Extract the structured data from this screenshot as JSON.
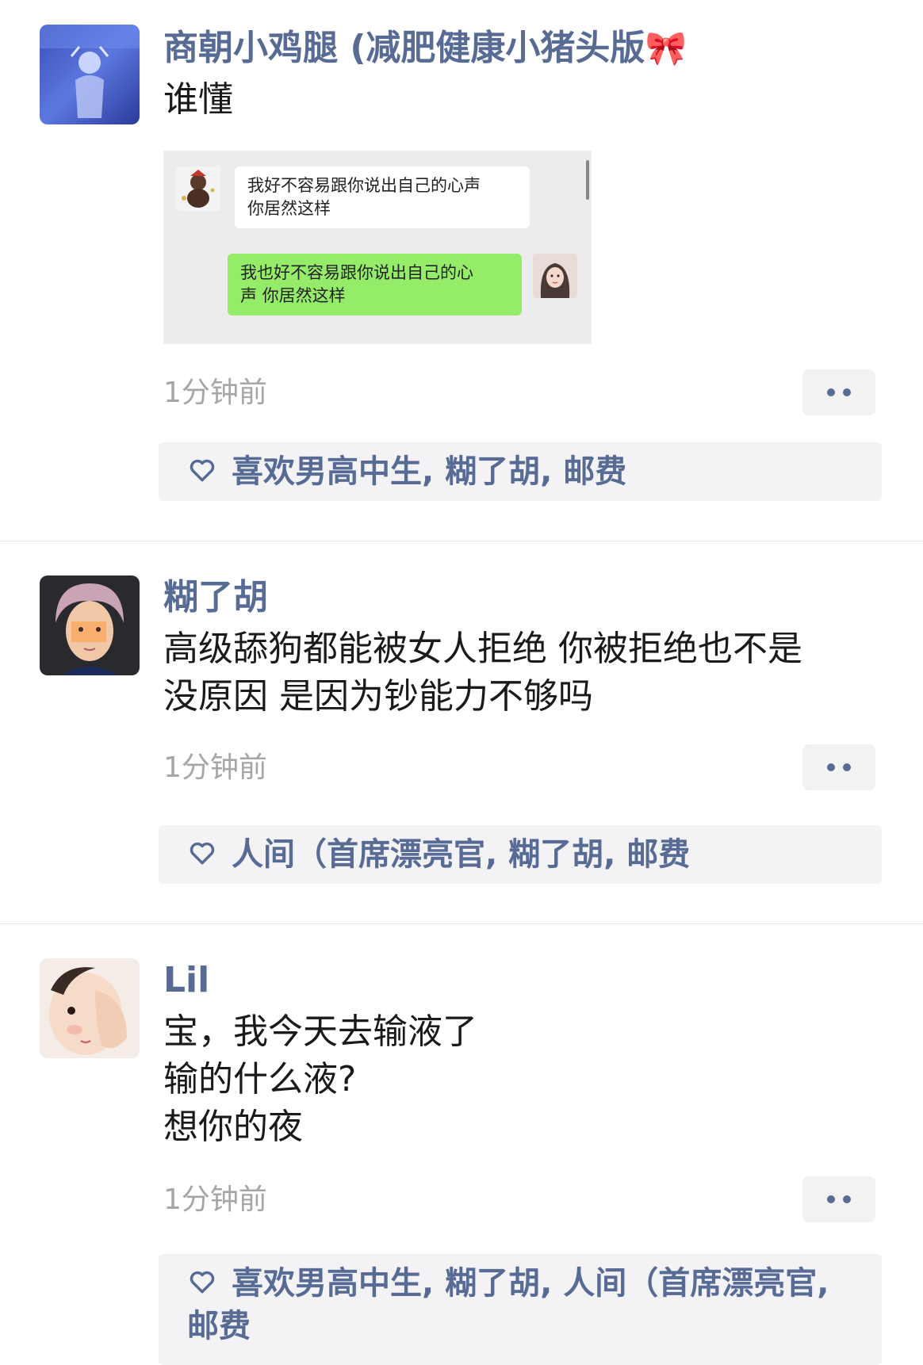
{
  "posts": [
    {
      "name": "商朝小鸡腿 (减肥健康小猪头版",
      "name_emoji": "🎀",
      "text": "谁懂",
      "chat_image": {
        "left_message": "我好不容易跟你说出自己的心声\n你居然这样",
        "right_message": "我也好不容易跟你说出自己的心\n声 你居然这样"
      },
      "time": "1分钟前",
      "likes": [
        "喜欢男高中生",
        "糊了胡",
        "邮费"
      ]
    },
    {
      "name": "糊了胡",
      "text": "高级舔狗都能被女人拒绝 你被拒绝也不是\n没原因 是因为钞能力不够吗",
      "time": "1分钟前",
      "likes": [
        "人间（首席漂亮官",
        "糊了胡",
        "邮费"
      ]
    },
    {
      "name": "Lil",
      "text": "宝，我今天去输液了\n输的什么液?\n想你的夜",
      "time": "1分钟前",
      "likes_line1": "喜欢男高中生, 糊了胡, 人间（首席漂亮官,",
      "likes_line2": "邮费"
    }
  ],
  "colors": {
    "link_blue": "#576b95",
    "time_gray": "#a6a6a6",
    "likes_bg": "#f3f3f5",
    "wechat_green": "#95ec69"
  },
  "icons": [
    "heart-outline-icon",
    "more-dots-icon"
  ]
}
